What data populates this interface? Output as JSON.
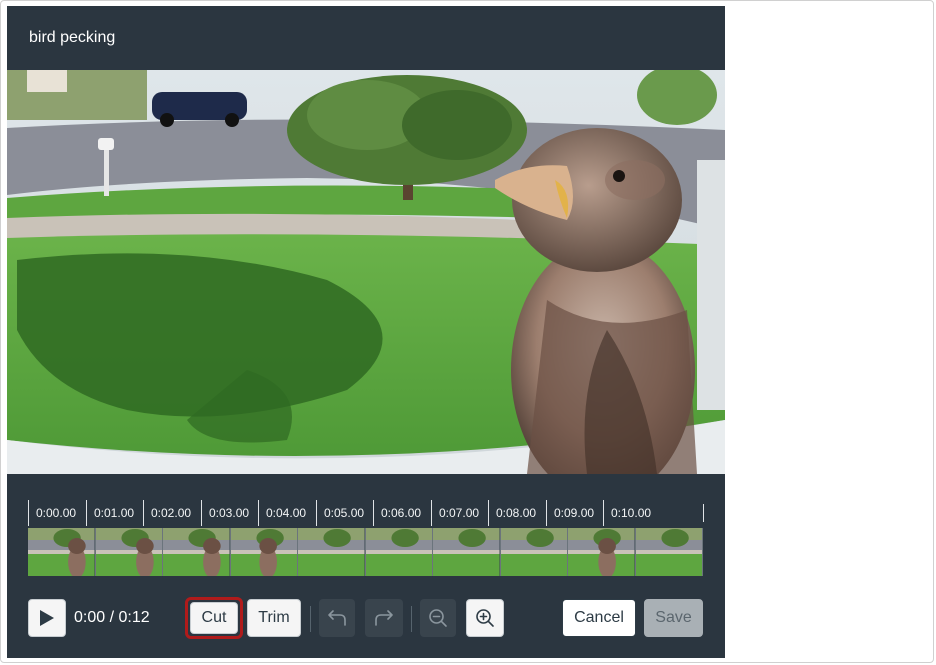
{
  "editor": {
    "title": "bird pecking"
  },
  "timeline": {
    "ticks": [
      "0:00.00",
      "0:01.00",
      "0:02.00",
      "0:03.00",
      "0:04.00",
      "0:05.00",
      "0:06.00",
      "0:07.00",
      "0:08.00",
      "0:09.00",
      "0:10.00"
    ],
    "frame_count": 10
  },
  "controls": {
    "time": "0:00 / 0:12",
    "cut_label": "Cut",
    "trim_label": "Trim",
    "cancel_label": "Cancel",
    "save_label": "Save",
    "play_icon": "play-icon",
    "undo_icon": "undo-icon",
    "redo_icon": "redo-icon",
    "zoom_out_icon": "zoom-out-icon",
    "zoom_in_icon": "zoom-in-icon"
  },
  "colors": {
    "panel": "#2b3640",
    "cut_highlight": "#b01b1b"
  }
}
